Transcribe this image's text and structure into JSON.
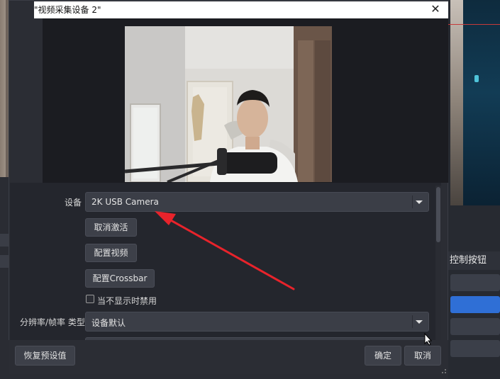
{
  "dialog": {
    "title": "\"视频采集设备 2\"",
    "close_label": "✕"
  },
  "properties": {
    "device_label": "设备",
    "device_value": "2K USB Camera",
    "deactivate_label": "取消激活",
    "config_video_label": "配置视频",
    "config_crossbar_label": "配置Crossbar",
    "disable_hidden_label": "当不显示时禁用",
    "disable_hidden_checked": false,
    "resolution_type_label": "分辨率/帧率 类型",
    "resolution_type_value": "设备默认"
  },
  "footer": {
    "restore_defaults_label": "恢复预设值",
    "ok_label": "确定",
    "cancel_label": "取消"
  },
  "background": {
    "panel_title_fragment": "控制按钮"
  },
  "colors": {
    "annotation_arrow": "#e8232b",
    "accent_blue": "#2f6fd6"
  }
}
